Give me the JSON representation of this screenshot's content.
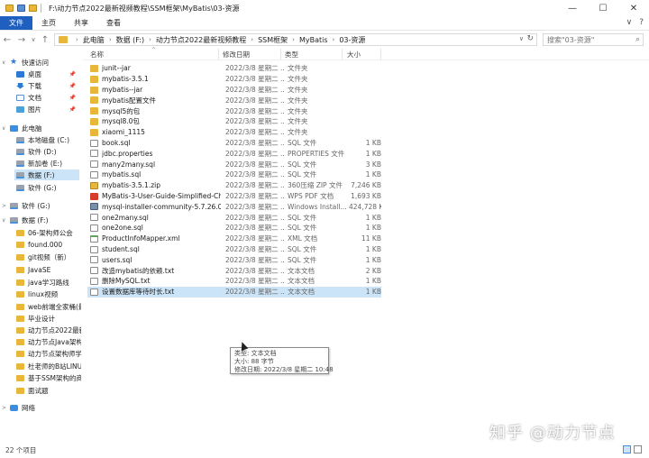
{
  "window": {
    "title": "F:\\动力节点2022最新视频教程\\SSM框架\\MyBatis\\03-资源",
    "minimize": "—",
    "maximize": "☐",
    "close": "✕"
  },
  "ribbon": {
    "tabs": [
      "文件",
      "主页",
      "共享",
      "查看"
    ],
    "expand": "∨",
    "help": "?"
  },
  "nav": {
    "back": "←",
    "forward": "→",
    "recent": "∨",
    "up": "↑",
    "breadcrumbs": [
      "此电脑",
      "数据 (F:)",
      "动力节点2022最新视频教程",
      "SSM框架",
      "MyBatis",
      "03-资源"
    ],
    "dropdown": "∨",
    "refresh": "↻"
  },
  "search": {
    "placeholder": "搜索\"03-资源\"",
    "icon": "search-icon"
  },
  "sidebar": {
    "items": [
      {
        "label": "快速访问",
        "icon": "star-icon",
        "arrow": "∨"
      },
      {
        "label": "桌面",
        "icon": "desktop-icon",
        "pin": true
      },
      {
        "label": "下载",
        "icon": "download-icon",
        "pin": true
      },
      {
        "label": "文档",
        "icon": "documents-icon",
        "pin": true
      },
      {
        "label": "图片",
        "icon": "pictures-icon",
        "pin": true
      },
      {
        "label": "此电脑",
        "icon": "computer-icon",
        "arrow": "∨"
      },
      {
        "label": "本地磁盘 (C:)",
        "icon": "drive-icon"
      },
      {
        "label": "软件 (D:)",
        "icon": "drive-icon"
      },
      {
        "label": "新加卷 (E:)",
        "icon": "drive-icon"
      },
      {
        "label": "数据 (F:)",
        "icon": "drive-icon",
        "selected": true
      },
      {
        "label": "软件 (G:)",
        "icon": "drive-icon"
      },
      {
        "label": "软件 (G:)",
        "icon": "drive-icon",
        "arrow": ">"
      },
      {
        "label": "数据 (F:)",
        "icon": "drive-icon",
        "arrow": "∨"
      },
      {
        "label": "06-架构师公会",
        "icon": "folder-icon"
      },
      {
        "label": "found.000",
        "icon": "folder-icon"
      },
      {
        "label": "git视频（新）",
        "icon": "folder-icon"
      },
      {
        "label": "JavaSE",
        "icon": "folder-icon"
      },
      {
        "label": "java学习路线",
        "icon": "folder-icon"
      },
      {
        "label": "linux视频",
        "icon": "folder-icon"
      },
      {
        "label": "web前端全家桶(最",
        "icon": "folder-icon"
      },
      {
        "label": "毕业设计",
        "icon": "folder-icon"
      },
      {
        "label": "动力节点2022最新",
        "icon": "folder-icon"
      },
      {
        "label": "动力节点Java架构",
        "icon": "folder-icon"
      },
      {
        "label": "动力节点架构师学",
        "icon": "folder-icon"
      },
      {
        "label": "杜老师的B站LINUX",
        "icon": "folder-icon"
      },
      {
        "label": "基于SSM架构的商品",
        "icon": "folder-icon"
      },
      {
        "label": "面试题",
        "icon": "folder-icon"
      },
      {
        "label": "网络",
        "icon": "network-icon",
        "arrow": ">"
      }
    ]
  },
  "columns": {
    "name": "名称",
    "date": "修改日期",
    "type": "类型",
    "size": "大小",
    "sort_arrow": "^"
  },
  "files": [
    {
      "name": "junit--jar",
      "date": "2022/3/8 星期二 ...",
      "type": "文件夹",
      "size": "",
      "icon": "folder"
    },
    {
      "name": "mybatis-3.5.1",
      "date": "2022/3/8 星期二 ...",
      "type": "文件夹",
      "size": "",
      "icon": "folder"
    },
    {
      "name": "mybatis--jar",
      "date": "2022/3/8 星期二 ...",
      "type": "文件夹",
      "size": "",
      "icon": "folder"
    },
    {
      "name": "mybatis配置文件",
      "date": "2022/3/8 星期二 ...",
      "type": "文件夹",
      "size": "",
      "icon": "folder"
    },
    {
      "name": "mysql5的包",
      "date": "2022/3/8 星期二 ...",
      "type": "文件夹",
      "size": "",
      "icon": "folder"
    },
    {
      "name": "mysql8.0包",
      "date": "2022/3/8 星期二 ...",
      "type": "文件夹",
      "size": "",
      "icon": "folder"
    },
    {
      "name": "xiaomi_1115",
      "date": "2022/3/8 星期二 ...",
      "type": "文件夹",
      "size": "",
      "icon": "folder"
    },
    {
      "name": "book.sql",
      "date": "2022/3/8 星期二 ...",
      "type": "SQL 文件",
      "size": "1 KB",
      "icon": "doc"
    },
    {
      "name": "jdbc.properties",
      "date": "2022/3/8 星期二 ...",
      "type": "PROPERTIES 文件",
      "size": "1 KB",
      "icon": "doc"
    },
    {
      "name": "many2many.sql",
      "date": "2022/3/8 星期二 ...",
      "type": "SQL 文件",
      "size": "3 KB",
      "icon": "doc"
    },
    {
      "name": "mybatis.sql",
      "date": "2022/3/8 星期二 ...",
      "type": "SQL 文件",
      "size": "1 KB",
      "icon": "doc"
    },
    {
      "name": "mybatis-3.5.1.zip",
      "date": "2022/3/8 星期二 ...",
      "type": "360压缩 ZIP 文件",
      "size": "7,246 KB",
      "icon": "zip"
    },
    {
      "name": "MyBatis-3-User-Guide-Simplified-Chi...",
      "date": "2022/3/8 星期二 ...",
      "type": "WPS PDF 文档",
      "size": "1,693 KB",
      "icon": "pdf"
    },
    {
      "name": "mysql-installer-community-5.7.26.0.msi",
      "date": "2022/3/8 星期二 ...",
      "type": "Windows Install...",
      "size": "424,728 KB",
      "icon": "msi"
    },
    {
      "name": "one2many.sql",
      "date": "2022/3/8 星期二 ...",
      "type": "SQL 文件",
      "size": "1 KB",
      "icon": "doc"
    },
    {
      "name": "one2one.sql",
      "date": "2022/3/8 星期二 ...",
      "type": "SQL 文件",
      "size": "1 KB",
      "icon": "doc"
    },
    {
      "name": "ProductInfoMapper.xml",
      "date": "2022/3/8 星期二 ...",
      "type": "XML 文档",
      "size": "11 KB",
      "icon": "xml"
    },
    {
      "name": "student.sql",
      "date": "2022/3/8 星期二 ...",
      "type": "SQL 文件",
      "size": "1 KB",
      "icon": "doc"
    },
    {
      "name": "users.sql",
      "date": "2022/3/8 星期二 ...",
      "type": "SQL 文件",
      "size": "1 KB",
      "icon": "doc"
    },
    {
      "name": "改造mybatis的依赖.txt",
      "date": "2022/3/8 星期二 ...",
      "type": "文本文档",
      "size": "2 KB",
      "icon": "doc"
    },
    {
      "name": "删除MySQL.txt",
      "date": "2022/3/8 星期二 ...",
      "type": "文本文档",
      "size": "1 KB",
      "icon": "doc"
    },
    {
      "name": "设置数据库等待时长.txt",
      "date": "2022/3/8 星期二 ...",
      "type": "文本文档",
      "size": "1 KB",
      "icon": "doc",
      "selected": true
    }
  ],
  "tooltip": {
    "type": "类型: 文本文档",
    "size": "大小: 88 字节",
    "modified": "修改日期: 2022/3/8 星期二 10:48"
  },
  "status": {
    "count": "22 个项目"
  },
  "watermark": "知乎 @动力节点"
}
